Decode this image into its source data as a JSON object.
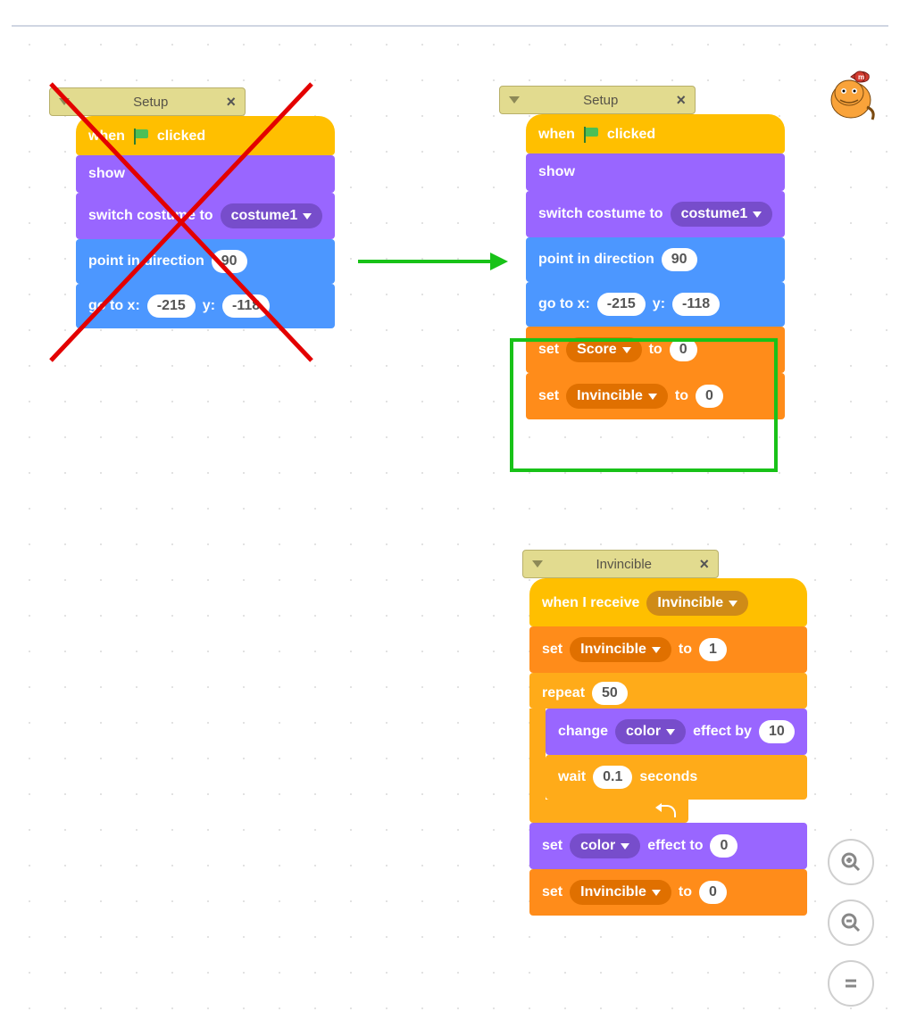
{
  "comments": {
    "setup_left": "Setup",
    "setup_right": "Setup",
    "invincible": "Invincible"
  },
  "blocks": {
    "when_flag_clicked_pre": "when",
    "when_flag_clicked_post": "clicked",
    "show": "show",
    "switch_costume_to": "switch costume to",
    "costume1": "costume1",
    "point_in_direction": "point in direction",
    "dir_val": "90",
    "goto_x": "go to x:",
    "goto_y": "y:",
    "x_val": "-215",
    "y_val": "-118",
    "set": "set",
    "to": "to",
    "score_var": "Score",
    "invincible_var": "Invincible",
    "zero": "0",
    "one": "1",
    "when_i_receive": "when I receive",
    "invincible_msg": "Invincible",
    "repeat": "repeat",
    "repeat_val": "50",
    "change": "change",
    "color": "color",
    "effect_by": "effect by",
    "effect_by_val": "10",
    "wait": "wait",
    "wait_val": "0.1",
    "seconds": "seconds",
    "effect_to": "effect to"
  }
}
